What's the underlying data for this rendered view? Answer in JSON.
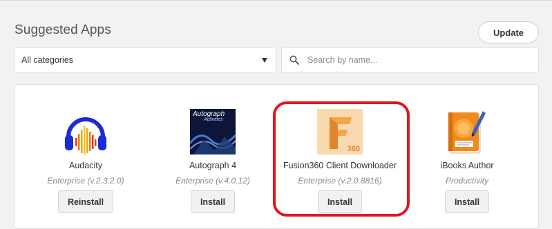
{
  "header": {
    "title": "Suggested Apps",
    "update_label": "Update"
  },
  "filters": {
    "category_value": "All categories",
    "search_placeholder": "Search by name..."
  },
  "apps": [
    {
      "name": "Audacity",
      "meta": "Enterprise (v.2.3.2.0)",
      "action": "Reinstall"
    },
    {
      "name": "Autograph 4",
      "meta": "Enterprise (v.4.0.12)",
      "action": "Install",
      "icon_text_1": "Autograph",
      "icon_text_2": "Activities"
    },
    {
      "name": "Fusion360 Client Downloader",
      "meta": "Enterprise (v.2.0.8816)",
      "action": "Install",
      "icon_badge": "360"
    },
    {
      "name": "iBooks Author",
      "meta": "Productivity",
      "action": "Install"
    }
  ],
  "colors": {
    "highlight": "#e3161b",
    "audacity_blue": "#1a2bd8",
    "fusion_orange": "#f2a54a"
  }
}
